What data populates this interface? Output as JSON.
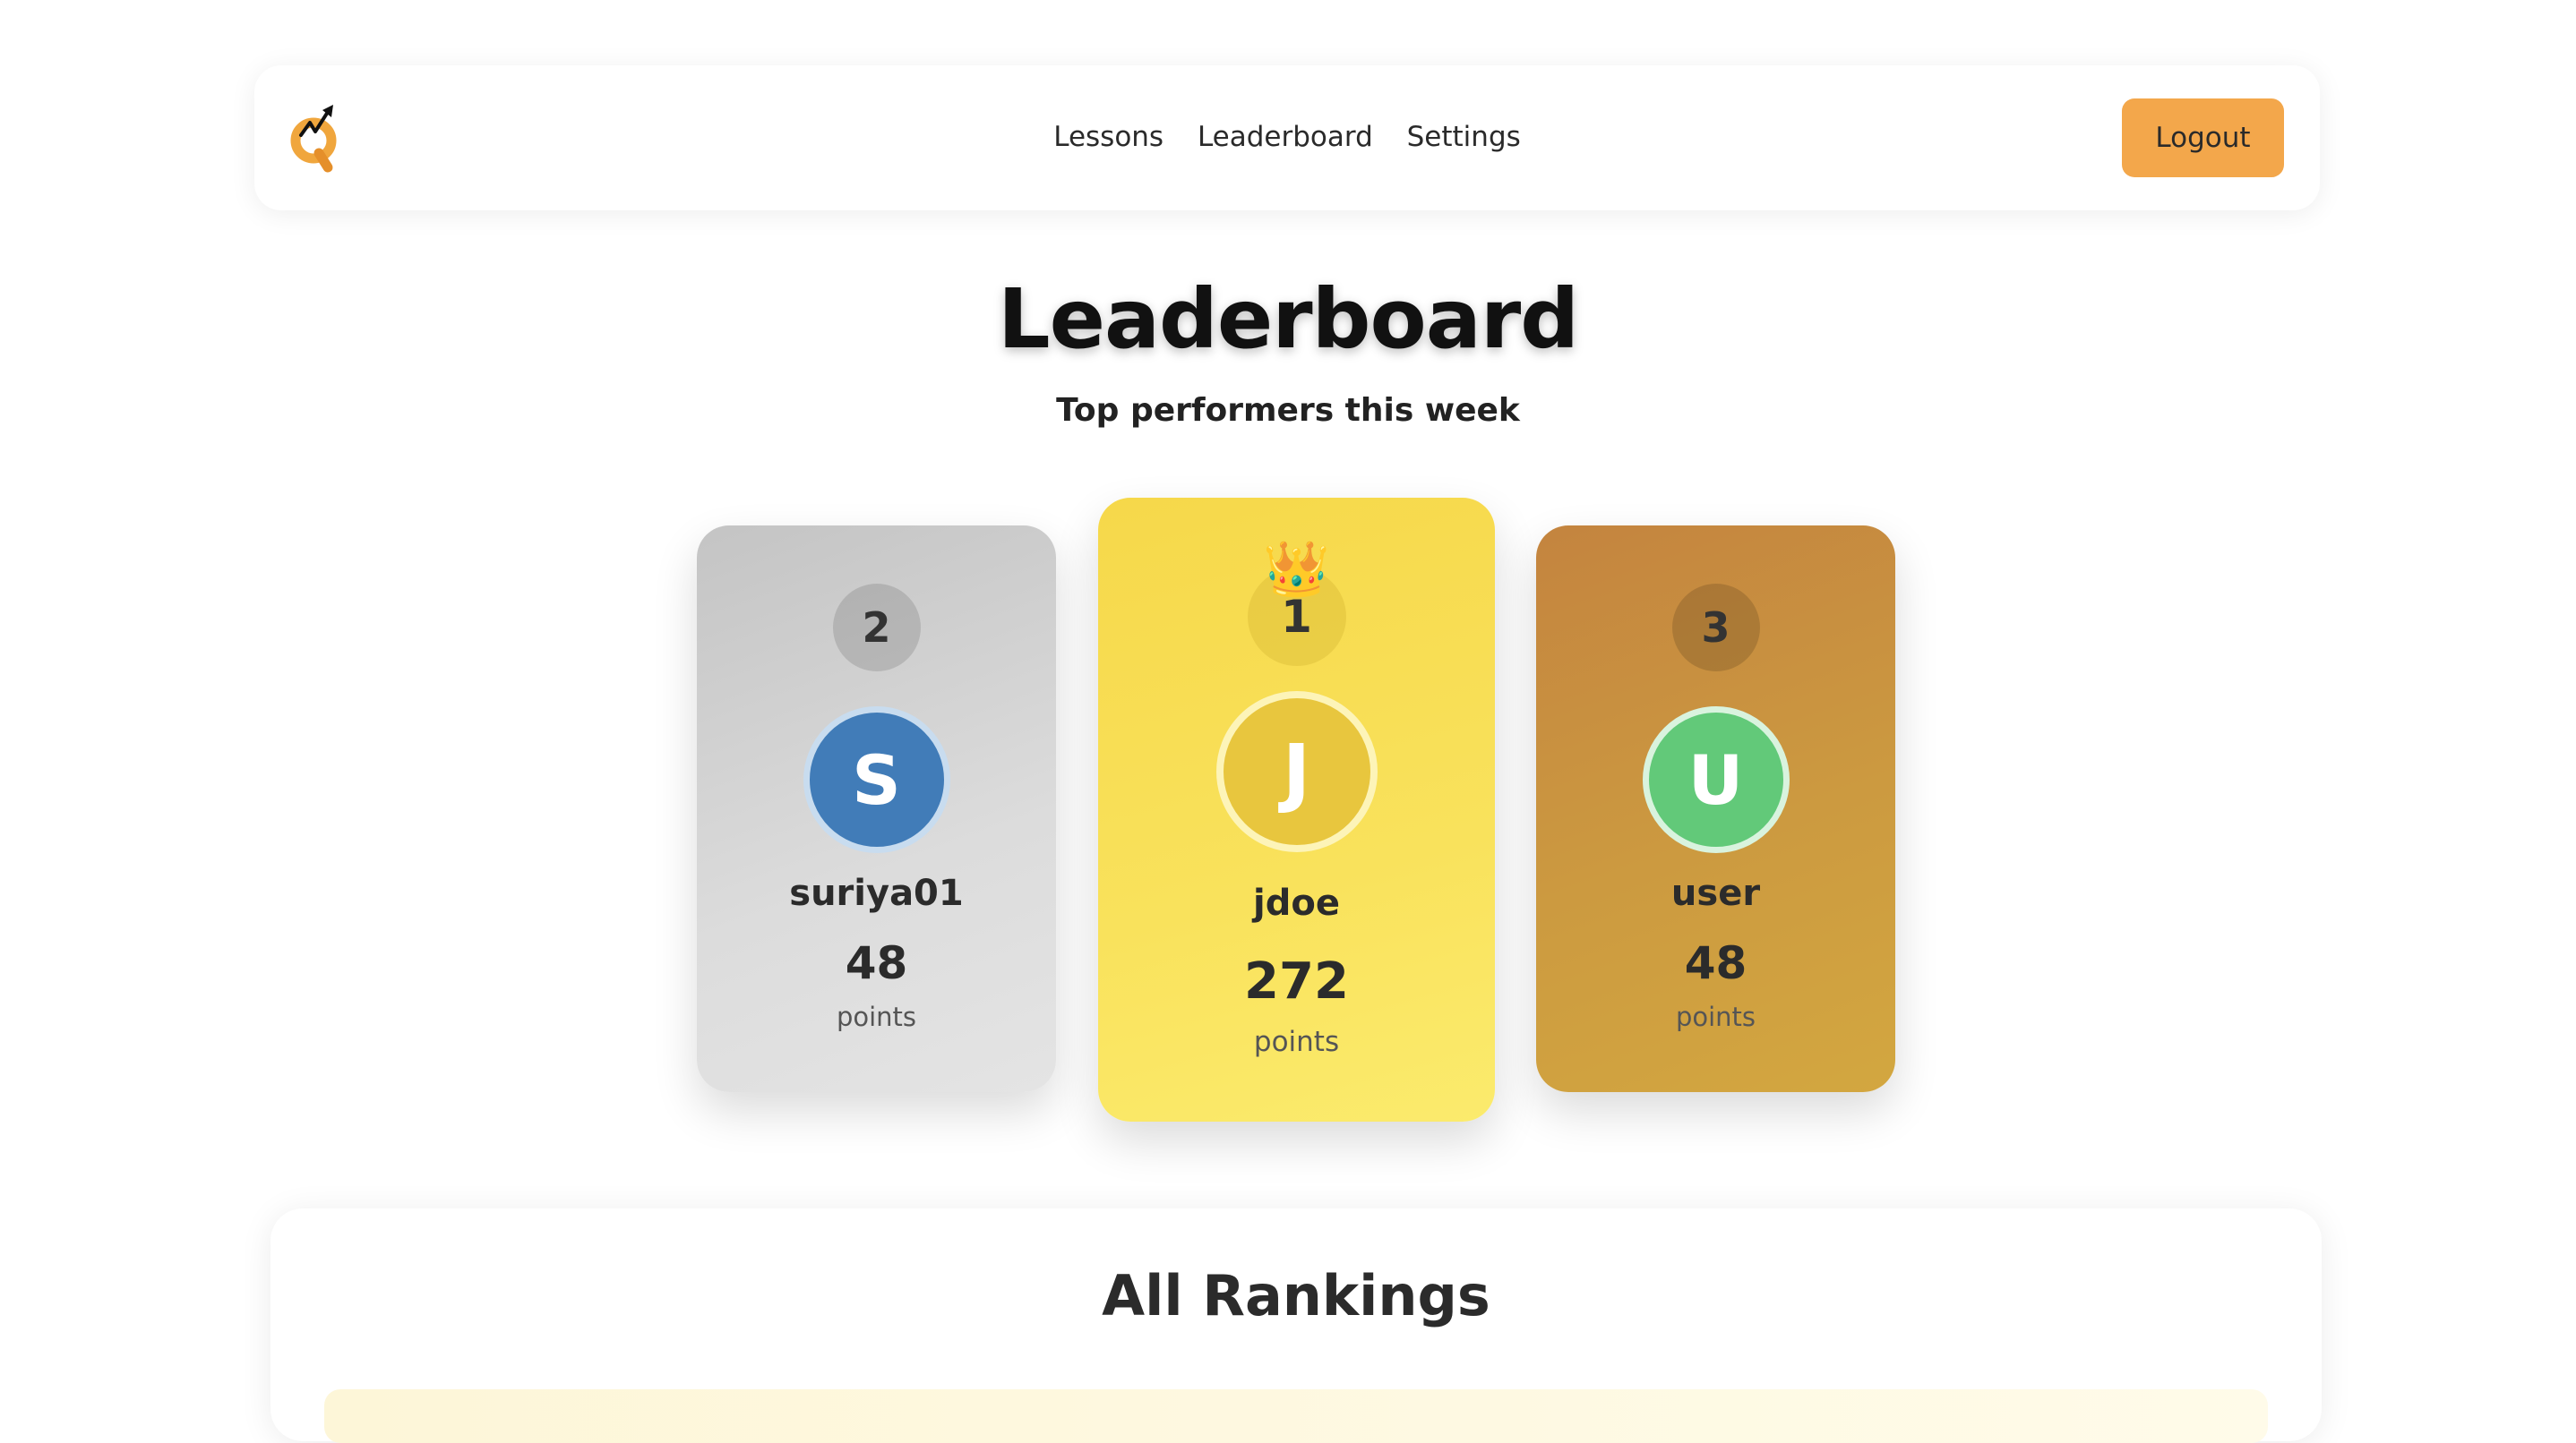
{
  "nav": {
    "links": [
      "Lessons",
      "Leaderboard",
      "Settings"
    ],
    "logout_label": "Logout"
  },
  "header": {
    "title": "Leaderboard",
    "subtitle": "Top performers this week"
  },
  "podium": [
    {
      "rank": "2",
      "initial": "S",
      "username": "suriya01",
      "points": "48",
      "points_label": "points",
      "avatar_color": "#417cb8"
    },
    {
      "rank": "1",
      "initial": "J",
      "username": "jdoe",
      "points": "272",
      "points_label": "points",
      "avatar_color": "#e8c63e",
      "crown": "👑"
    },
    {
      "rank": "3",
      "initial": "U",
      "username": "user",
      "points": "48",
      "points_label": "points",
      "avatar_color": "#62c979"
    }
  ],
  "rankings": {
    "title": "All Rankings"
  },
  "colors": {
    "accent": "#f3a74b",
    "gold": "#f7dc50",
    "silver": "#cfcfcf",
    "bronze": "#c98f3f"
  }
}
